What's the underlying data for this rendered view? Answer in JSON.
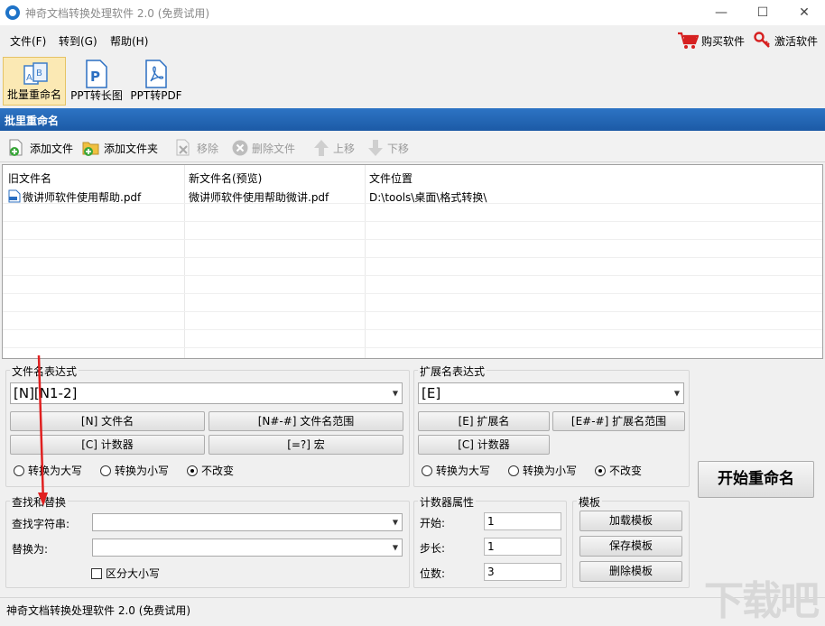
{
  "window": {
    "title": "神奇文档转换处理软件 2.0 (免费试用)",
    "minimize": "—",
    "maximize": "☐",
    "close": "✕"
  },
  "menu": {
    "file": "文件(F)",
    "goto": "转到(G)",
    "help": "帮助(H)",
    "buy": "购买软件",
    "activate": "激活软件"
  },
  "tools": {
    "batch_rename": "批量重命名",
    "ppt_to_long": "PPT转长图",
    "ppt_to_pdf": "PPT转PDF"
  },
  "section_title": "批里重命名",
  "subtoolbar": {
    "add_file": "添加文件",
    "add_folder": "添加文件夹",
    "remove": "移除",
    "delete_file": "删除文件",
    "move_up": "上移",
    "move_down": "下移"
  },
  "table": {
    "headers": [
      "旧文件名",
      "新文件名(预览)",
      "文件位置"
    ],
    "rows": [
      [
        "微讲师软件使用帮助.pdf",
        "微讲师软件使用帮助微讲.pdf",
        "D:\\tools\\桌面\\格式转换\\"
      ]
    ]
  },
  "filename_expr": {
    "label": "文件名表达式",
    "value": "[N][N1-2]",
    "btn_name": "[N] 文件名",
    "btn_range": "[N#-#] 文件名范围",
    "btn_counter": "[C] 计数器",
    "btn_macro": "[=?] 宏",
    "upper": "转换为大写",
    "lower": "转换为小写",
    "unchanged": "不改变"
  },
  "ext_expr": {
    "label": "扩展名表达式",
    "value": "[E]",
    "btn_ext": "[E] 扩展名",
    "btn_range": "[E#-#] 扩展名范围",
    "btn_counter": "[C] 计数器",
    "upper": "转换为大写",
    "lower": "转换为小写",
    "unchanged": "不改变"
  },
  "start_button": "开始重命名",
  "find_replace": {
    "label": "查找和替换",
    "find": "查找字符串:",
    "replace": "替换为:",
    "case": "区分大小写"
  },
  "counter": {
    "label": "计数器属性",
    "start": "开始:",
    "start_val": "1",
    "step": "步长:",
    "step_val": "1",
    "digits": "位数:",
    "digits_val": "3"
  },
  "template": {
    "label": "模板",
    "load": "加载模板",
    "save": "保存模板",
    "delete": "删除模板"
  },
  "status": "神奇文档转换处理软件 2.0 (免费试用)",
  "watermark": "下载吧",
  "colors": {
    "accent": "#1c5aa6",
    "arrow": "#e02020",
    "cart": "#d62020"
  }
}
